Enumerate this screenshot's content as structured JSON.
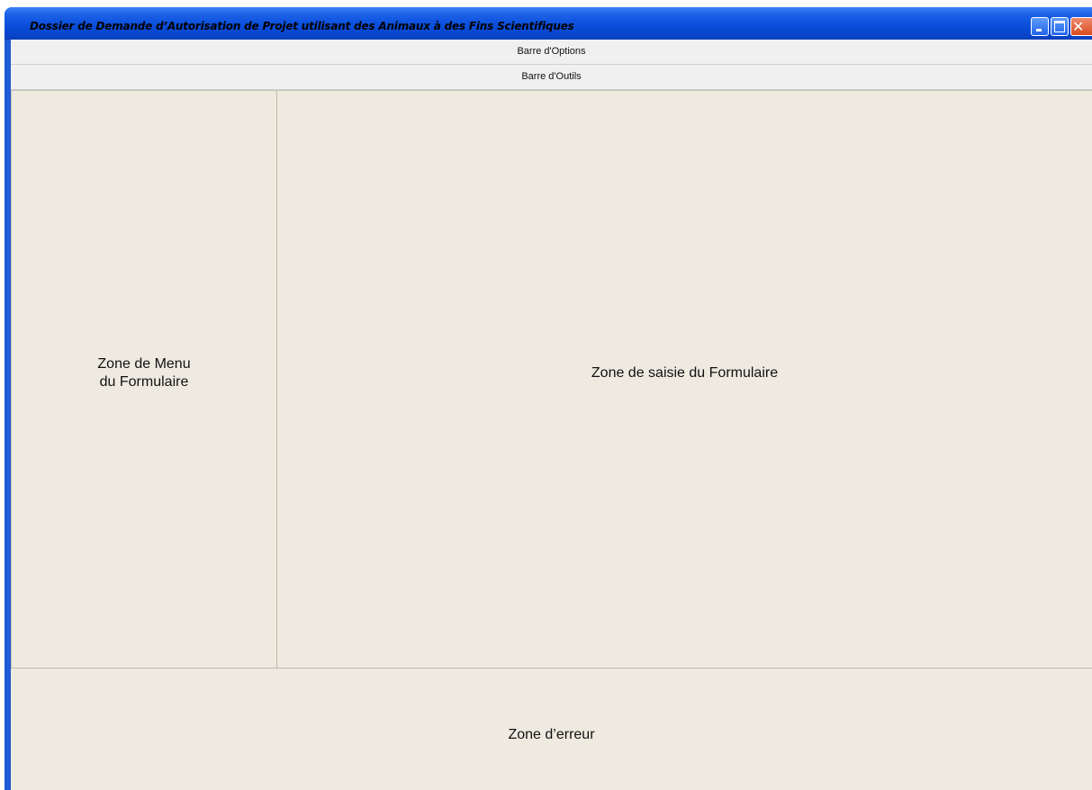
{
  "window": {
    "title": "Dossier de Demande  d’Autorisation de Projet utilisant des Animaux à des Fins Scientifiques"
  },
  "bars": {
    "options": "Barre d'Options",
    "tools": "Barre d'Outils"
  },
  "zones": {
    "menu_line1": "Zone de Menu",
    "menu_line2": "du Formulaire",
    "saisie": "Zone de saisie du Formulaire",
    "erreur": "Zone d’erreur"
  },
  "icons": {
    "minimize": "minimize-icon",
    "maximize": "maximize-icon",
    "close": "close-icon"
  },
  "colors": {
    "titlebar": "#0a4fdc",
    "frame": "#1e5bd6",
    "client": "#ece9dd",
    "close_button": "#d84b21"
  }
}
